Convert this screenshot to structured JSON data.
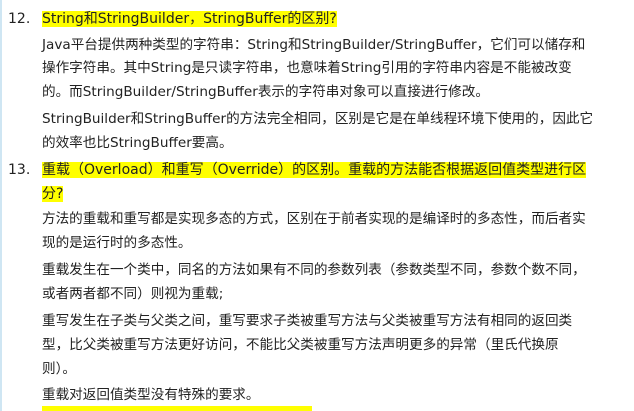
{
  "items": [
    {
      "number": "12.",
      "question": "String和StringBuilder，StringBuffer的区别?",
      "answer_lines": [
        "Java平台提供两种类型的字符串：String和StringBuilder/StringBuffer，它们可以储存和",
        "操作字符串。其中String是只读字符串，也意味着String引用的字符串内容是不能被改变",
        "的。而StringBuilder/StringBuffer表示的字符串对象可以直接进行修改。",
        "StringBuilder和StringBuffer的方法完全相同，区别是它是在单线程环境下使用的，因此它",
        "的效率也比StringBuffer要高。"
      ]
    },
    {
      "number": "13.",
      "question_lines": [
        "重载（Overload）和重写（Override）的区别。重载的方法能否根据返回值类型进行区",
        "分?"
      ],
      "answer_lines": [
        "方法的重载和重写都是实现多态的方式，区别在于前者实现的是编译时的多态性，而后者实",
        "现的是运行时的多态性。",
        "重载发生在一个类中，同名的方法如果有不同的参数列表（参数类型不同，参数个数不同，",
        "或者两者都不同）则视为重载;",
        "重写发生在子类与父类之间，重写要求子类被重写方法与父类被重写方法有相同的返回类",
        "型，比父类被重写方法更好访问，不能比父类被重写方法声明更多的异常（里氏代换原",
        "则）。",
        "重载对返回值类型没有特殊的要求。"
      ]
    }
  ]
}
